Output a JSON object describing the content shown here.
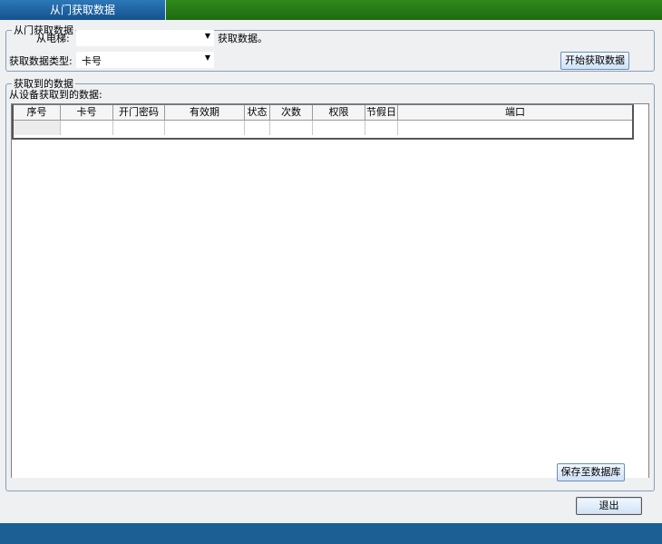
{
  "window": {
    "title": "从门获取数据"
  },
  "section1": {
    "legend": "从门获取数据",
    "elevator_label": "从电梯:",
    "elevator_value": "",
    "fetch_hint": "获取数据。",
    "type_label": "获取数据类型:",
    "type_value": "卡号",
    "start_button": "开始获取数据"
  },
  "section2": {
    "legend": "获取到的数据",
    "caption": "从设备获取到的数据:",
    "columns": [
      "序号",
      "卡号",
      "开门密码",
      "有效期",
      "状态",
      "次数",
      "权限",
      "节假日",
      "端口"
    ],
    "save_button": "保存至数据库"
  },
  "footer": {
    "exit_button": "退出"
  },
  "colors": {
    "title_green": "#2f8a1c",
    "title_blue": "#14528e",
    "bottom_bar": "#1b5f95",
    "panel_bg": "#eef0f2"
  }
}
